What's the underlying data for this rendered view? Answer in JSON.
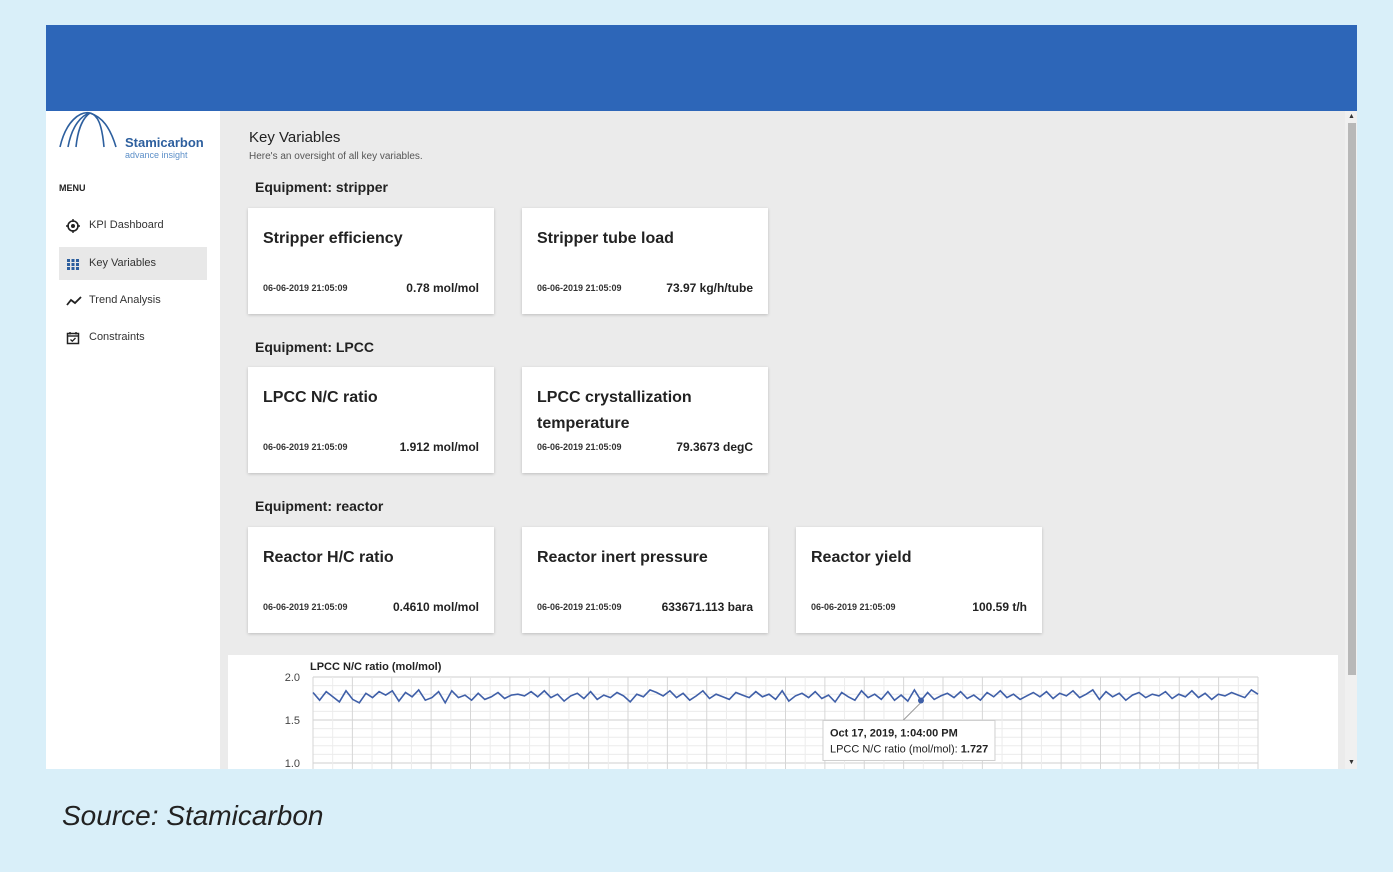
{
  "app": {
    "logo_name": "Stamicarbon",
    "logo_sub": "advance insight",
    "brand_color": "#2d66b8"
  },
  "sidebar": {
    "menu_title": "MENU",
    "items": [
      {
        "label": "KPI Dashboard",
        "icon": "target-icon",
        "active": false
      },
      {
        "label": "Key Variables",
        "icon": "grid-icon",
        "active": true
      },
      {
        "label": "Trend Analysis",
        "icon": "trend-icon",
        "active": false
      },
      {
        "label": "Constraints",
        "icon": "calendar-check-icon",
        "active": false
      }
    ]
  },
  "main": {
    "title": "Key Variables",
    "subtitle": "Here's an oversight of all key variables.",
    "sections": [
      {
        "title": "Equipment: stripper",
        "cards": [
          {
            "title": "Stripper efficiency",
            "time": "06-06-2019 21:05:09",
            "value": "0.78 mol/mol"
          },
          {
            "title": "Stripper tube load",
            "time": "06-06-2019 21:05:09",
            "value": "73.97 kg/h/tube"
          }
        ]
      },
      {
        "title": "Equipment: LPCC",
        "cards": [
          {
            "title": "LPCC N/C ratio",
            "time": "06-06-2019 21:05:09",
            "value": "1.912 mol/mol"
          },
          {
            "title": "LPCC crystallization temperature",
            "time": "06-06-2019 21:05:09",
            "value": "79.3673 degC"
          }
        ]
      },
      {
        "title": "Equipment: reactor",
        "cards": [
          {
            "title": "Reactor H/C ratio",
            "time": "06-06-2019 21:05:09",
            "value": "0.4610 mol/mol"
          },
          {
            "title": "Reactor inert pressure",
            "time": "06-06-2019 21:05:09",
            "value": "633671.113 bara"
          },
          {
            "title": "Reactor yield",
            "time": "06-06-2019 21:05:09",
            "value": "100.59 t/h"
          }
        ]
      }
    ]
  },
  "chart_data": {
    "type": "line",
    "title": "LPCC N/C ratio (mol/mol)",
    "ylim": [
      1.0,
      2.0
    ],
    "yticks": [
      "2.0",
      "1.5",
      "1.0"
    ],
    "grid": true,
    "line_color": "#3f5fa8",
    "series": [
      {
        "values": [
          1.82,
          1.73,
          1.83,
          1.77,
          1.71,
          1.84,
          1.74,
          1.7,
          1.81,
          1.76,
          1.83,
          1.79,
          1.84,
          1.72,
          1.82,
          1.77,
          1.85,
          1.73,
          1.76,
          1.83,
          1.7,
          1.84,
          1.76,
          1.79,
          1.73,
          1.81,
          1.74,
          1.77,
          1.82,
          1.75,
          1.79,
          1.8,
          1.78,
          1.83,
          1.77,
          1.84,
          1.76,
          1.8,
          1.72,
          1.78,
          1.81,
          1.75,
          1.83,
          1.74,
          1.79,
          1.76,
          1.82,
          1.78,
          1.71,
          1.8,
          1.77,
          1.85,
          1.82,
          1.78,
          1.84,
          1.76,
          1.81,
          1.73,
          1.78,
          1.84,
          1.75,
          1.8,
          1.77,
          1.74,
          1.82,
          1.79,
          1.76,
          1.83,
          1.77,
          1.8,
          1.74,
          1.84,
          1.72,
          1.78,
          1.81,
          1.76,
          1.83,
          1.75,
          1.79,
          1.71,
          1.82,
          1.77,
          1.73,
          1.84,
          1.76,
          1.8,
          1.74,
          1.83,
          1.73,
          1.79,
          1.72,
          1.85,
          1.727,
          1.82,
          1.74,
          1.78,
          1.81,
          1.76,
          1.83,
          1.75,
          1.79,
          1.73,
          1.82,
          1.77,
          1.84,
          1.76,
          1.8,
          1.74,
          1.78,
          1.82,
          1.77,
          1.83,
          1.75,
          1.81,
          1.78,
          1.84,
          1.76,
          1.8,
          1.85,
          1.74,
          1.83,
          1.77,
          1.81,
          1.73,
          1.79,
          1.82,
          1.76,
          1.8,
          1.78,
          1.83,
          1.75,
          1.8,
          1.77,
          1.84,
          1.76,
          1.81,
          1.74,
          1.8,
          1.78,
          1.82,
          1.79,
          1.76,
          1.85,
          1.8
        ]
      }
    ],
    "tooltip": {
      "point_index": 92,
      "date": "Oct 17, 2019, 1:04:00 PM",
      "label": "LPCC N/C ratio (mol/mol): ",
      "value": "1.727"
    }
  },
  "footer": {
    "source": "Source: Stamicarbon"
  }
}
